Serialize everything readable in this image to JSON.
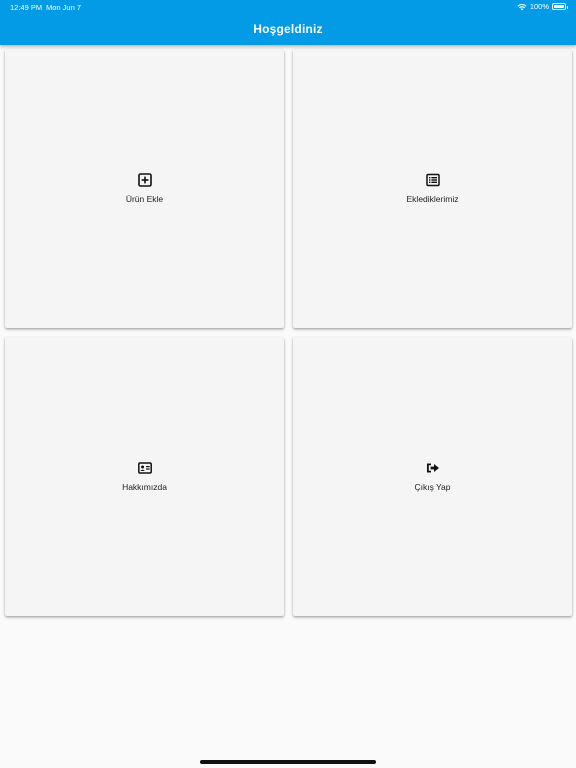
{
  "status_bar": {
    "time": "12:49 PM",
    "date": "Mon Jun 7",
    "battery": "100%",
    "icons": [
      "wifi-icon",
      "battery-icon"
    ]
  },
  "appbar": {
    "title": "Hoşgeldiniz",
    "color": "#039be5"
  },
  "cards": [
    {
      "label": "Ürün Ekle",
      "icon": "add-box-icon"
    },
    {
      "label": "Eklediklerimiz",
      "icon": "list-icon"
    },
    {
      "label": "Hakkımızda",
      "icon": "contact-card-icon"
    },
    {
      "label": "Çıkış Yap",
      "icon": "sign-out-icon"
    }
  ]
}
